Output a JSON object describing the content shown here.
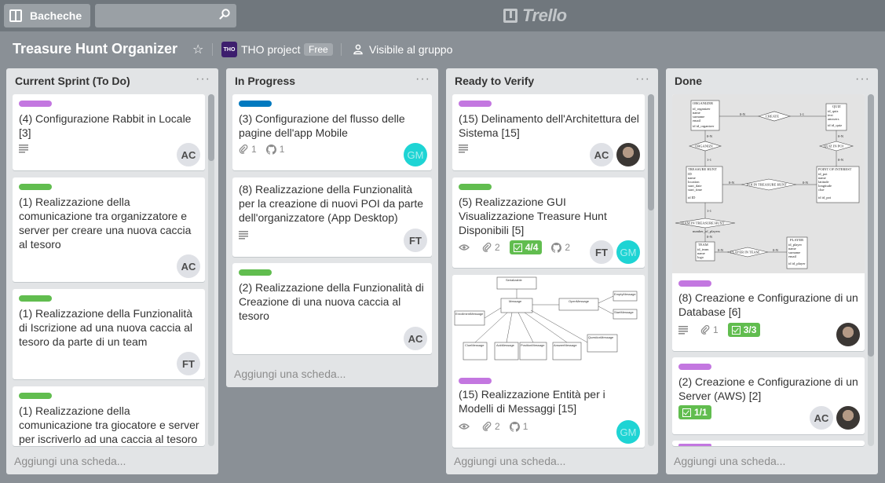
{
  "header": {
    "boards_label": "Bacheche",
    "logo_text": "Trello"
  },
  "board": {
    "title": "Treasure Hunt Organizer",
    "team_badge": "THO",
    "team_name": "THO project",
    "plan_badge": "Free",
    "visibility": "Visibile al gruppo"
  },
  "lists": [
    {
      "title": "Current Sprint (To Do)",
      "add_card": "Aggiungi una scheda...",
      "cards": [
        {
          "title": "(4) Configurazione Rabbit in Locale [3]",
          "label": "purple",
          "member": "AC"
        },
        {
          "title": "(1) Realizzazione della comunicazione tra organizzatore e server per creare una nuova caccia al tesoro",
          "label": "green",
          "member": "AC"
        },
        {
          "title": "(1) Realizzazione della Funzionalità di Iscrizione ad una nuova caccia al tesoro da parte di un team",
          "label": "green",
          "member": "FT"
        },
        {
          "title": "(1) Realizzazione della comunicazione tra giocatore e server per iscriverlo ad una caccia al tesoro",
          "label": "green"
        }
      ]
    },
    {
      "title": "In Progress",
      "add_card": "Aggiungi una scheda...",
      "cards": [
        {
          "title": "(3) Configurazione del flusso delle pagine dell'app Mobile",
          "label": "blue",
          "attachments": "1",
          "github": "1",
          "member": "GM"
        },
        {
          "title": "(8) Realizzazione della Funzionalità per la creazione di nuovi POI da parte dell'organizzatore (App Desktop)",
          "member": "FT"
        },
        {
          "title": "(2) Realizzazione della Funzionalità di Creazione di una nuova caccia al tesoro",
          "label": "green",
          "member": "AC"
        }
      ]
    },
    {
      "title": "Ready to Verify",
      "add_card": "Aggiungi una scheda...",
      "cards": [
        {
          "title": "(15) Delinamento dell'Architettura del Sistema [15]",
          "label": "purple",
          "member": "AC"
        },
        {
          "title": "(5) Realizzazione GUI Visualizzazione Treasure Hunt Disponibili [5]",
          "label": "green",
          "attachments": "2",
          "checklist": "4/4",
          "github": "2",
          "members": [
            "FT",
            "GM"
          ]
        },
        {
          "title": "(15) Realizzazione Entità per i Modelli di Messaggi [15]",
          "label": "purple",
          "attachments": "2",
          "github": "1",
          "member": "GM"
        }
      ]
    },
    {
      "title": "Done",
      "add_card": "Aggiungi una scheda...",
      "cards": [
        {
          "title": "(8) Creazione e Configurazione di un Database [6]",
          "label": "purple",
          "attachments": "1",
          "checklist": "3/3"
        },
        {
          "title": "(2) Creazione e Configurazione di un Server (AWS) [2]",
          "label": "purple",
          "checklist": "1/1",
          "member": "AC"
        }
      ]
    }
  ],
  "er_diagram": {
    "organizer": "ORGANIZER",
    "organizer_fields": [
      "id_organizer",
      "name",
      "surname",
      "email",
      "id id_organizer"
    ],
    "create": "CREATE",
    "quiz": "QUIZ",
    "quiz_fields": [
      "id_quiz",
      "text",
      "answers",
      "id id_quiz"
    ],
    "organize": "ORGANIZE",
    "quiz_in_poi": "QUIZ IN POI",
    "treasure_hunt": "TREASURE HUNT",
    "th_fields": [
      "ID",
      "name",
      "location",
      "start_date",
      "start_time",
      "id ID"
    ],
    "poi_in_th": "POI IN TREASURE HUNT",
    "poi": "POINT OF INTEREST",
    "poi_fields": [
      "id_poi",
      "name",
      "latitude",
      "longitude",
      "clue",
      "id id_poi"
    ],
    "team_in_th": "TEAM IN TREASURE HUNT",
    "number_of_players": "number_of_players",
    "team": "TEAM",
    "team_fields": [
      "id_team",
      "name",
      "logo"
    ],
    "player_in_team": "PLAYER IN TEAM",
    "player": "PLAYER",
    "player_fields": [
      "id_player",
      "name",
      "surname",
      "email",
      "id id_player"
    ],
    "card_1n": "0-N",
    "card_11": "1-1"
  },
  "uml_diagram": {
    "classes": [
      "Serializable",
      "Message",
      "EnrollmentMessage",
      "ClueMessage",
      "AckMessage",
      "PositionMessage",
      "AnswerMessage",
      "QuestionMessage",
      "OpenMessage",
      "EmptyMessage",
      "StartMessage"
    ]
  },
  "colors": {
    "label_purple": "#c377e0",
    "label_green": "#61bd4f",
    "label_blue": "#0079bf",
    "checklist_complete": "#61bd4f",
    "avatar_gm": "#1ed4d4"
  }
}
